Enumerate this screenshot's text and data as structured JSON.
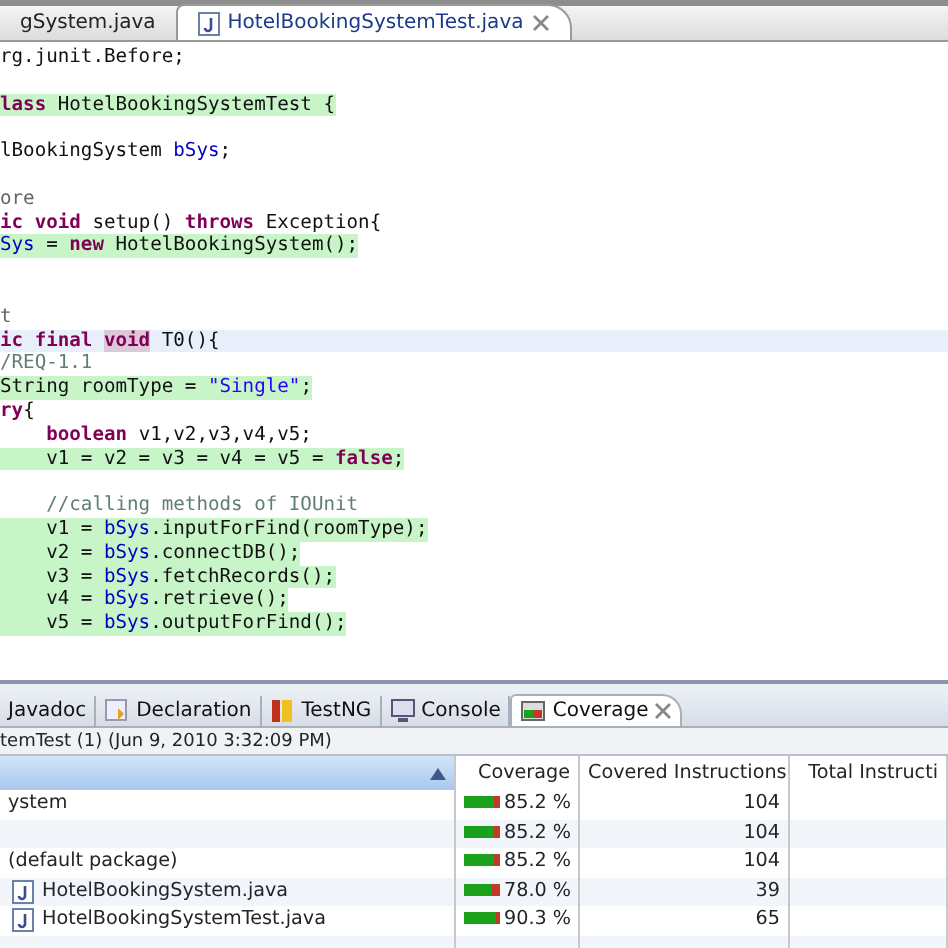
{
  "editor_tabs": [
    {
      "label": "gSystem.java",
      "selected": false,
      "closable": false,
      "icon": false
    },
    {
      "label": "HotelBookingSystemTest.java",
      "selected": true,
      "closable": true,
      "icon": true
    }
  ],
  "code_lines": [
    {
      "kind": "plain",
      "tokens": [
        {
          "kind": "plain",
          "text": "rg.junit.Before;"
        }
      ]
    },
    {
      "kind": "blank"
    },
    {
      "kind": "covered",
      "tokens": [
        {
          "kind": "keyword",
          "text": "lass"
        },
        {
          "kind": "plain",
          "text": " HotelBookingSystemTest {"
        }
      ]
    },
    {
      "kind": "blank"
    },
    {
      "kind": "plain",
      "tokens": [
        {
          "kind": "plain",
          "text": "lBookingSystem "
        },
        {
          "kind": "field",
          "text": "bSys"
        },
        {
          "kind": "plain",
          "text": ";"
        }
      ]
    },
    {
      "kind": "blank"
    },
    {
      "kind": "plain",
      "tokens": [
        {
          "kind": "annotation",
          "text": "ore"
        }
      ]
    },
    {
      "kind": "plain",
      "tokens": [
        {
          "kind": "keyword",
          "text": "ic void"
        },
        {
          "kind": "plain",
          "text": " setup() "
        },
        {
          "kind": "keyword",
          "text": "throws"
        },
        {
          "kind": "plain",
          "text": " Exception{"
        }
      ]
    },
    {
      "kind": "covered",
      "tokens": [
        {
          "kind": "field",
          "text": "Sys"
        },
        {
          "kind": "plain",
          "text": " = "
        },
        {
          "kind": "keyword",
          "text": "new"
        },
        {
          "kind": "plain",
          "text": " HotelBookingSystem();"
        }
      ]
    },
    {
      "kind": "blank"
    },
    {
      "kind": "blank"
    },
    {
      "kind": "plain",
      "tokens": [
        {
          "kind": "annotation",
          "text": "t"
        }
      ]
    },
    {
      "kind": "current",
      "tokens": [
        {
          "kind": "keyword",
          "text": "ic final "
        },
        {
          "kind": "marked",
          "text": "void"
        },
        {
          "kind": "plain",
          "text": " T0(){"
        }
      ]
    },
    {
      "kind": "plain",
      "tokens": [
        {
          "kind": "comment",
          "text": "/REQ-1.1"
        }
      ]
    },
    {
      "kind": "covered",
      "tokens": [
        {
          "kind": "plain",
          "text": "String roomType = "
        },
        {
          "kind": "string",
          "text": "\"Single\""
        },
        {
          "kind": "plain",
          "text": ";"
        }
      ]
    },
    {
      "kind": "plain",
      "tokens": [
        {
          "kind": "keyword",
          "text": "ry"
        },
        {
          "kind": "plain",
          "text": "{"
        }
      ]
    },
    {
      "kind": "plain",
      "tokens": [
        {
          "kind": "keyword",
          "text": "    boolean"
        },
        {
          "kind": "plain",
          "text": " v1,v2,v3,v4,v5;"
        }
      ]
    },
    {
      "kind": "covered",
      "tokens": [
        {
          "kind": "plain",
          "text": "    v1 = v2 = v3 = v4 = v5 = "
        },
        {
          "kind": "keyword",
          "text": "false"
        },
        {
          "kind": "plain",
          "text": ";"
        }
      ]
    },
    {
      "kind": "blank"
    },
    {
      "kind": "plain",
      "tokens": [
        {
          "kind": "comment",
          "text": "    //calling methods of IOUnit"
        }
      ]
    },
    {
      "kind": "covered",
      "tokens": [
        {
          "kind": "plain",
          "text": "    v1 = "
        },
        {
          "kind": "field",
          "text": "bSys"
        },
        {
          "kind": "plain",
          "text": ".inputForFind(roomType);"
        }
      ]
    },
    {
      "kind": "covered",
      "tokens": [
        {
          "kind": "plain",
          "text": "    v2 = "
        },
        {
          "kind": "field",
          "text": "bSys"
        },
        {
          "kind": "plain",
          "text": ".connectDB();"
        }
      ]
    },
    {
      "kind": "covered",
      "tokens": [
        {
          "kind": "plain",
          "text": "    v3 = "
        },
        {
          "kind": "field",
          "text": "bSys"
        },
        {
          "kind": "plain",
          "text": ".fetchRecords();"
        }
      ]
    },
    {
      "kind": "covered",
      "tokens": [
        {
          "kind": "plain",
          "text": "    v4 = "
        },
        {
          "kind": "field",
          "text": "bSys"
        },
        {
          "kind": "plain",
          "text": ".retrieve();"
        }
      ]
    },
    {
      "kind": "covered",
      "tokens": [
        {
          "kind": "plain",
          "text": "    v5 = "
        },
        {
          "kind": "field",
          "text": "bSys"
        },
        {
          "kind": "plain",
          "text": ".outputForFind();"
        }
      ]
    }
  ],
  "view_tabs": [
    {
      "label": "Javadoc",
      "kind": "plain",
      "selected": false,
      "closable": false
    },
    {
      "label": "Declaration",
      "kind": "declaration",
      "selected": false,
      "closable": false
    },
    {
      "label": "TestNG",
      "kind": "testng",
      "selected": false,
      "closable": false
    },
    {
      "label": "Console",
      "kind": "console",
      "selected": false,
      "closable": false
    },
    {
      "label": "Coverage",
      "kind": "coverage",
      "selected": true,
      "closable": true
    }
  ],
  "session": "temTest (1) (Jun 9, 2010 3:32:09 PM)",
  "table": {
    "columns": [
      {
        "sorted": true
      },
      {
        "label": "Coverage"
      },
      {
        "label": "Covered Instructions"
      },
      {
        "label": "Total Instructi"
      }
    ],
    "rows": [
      {
        "name": "ystem",
        "coverage": "85.2 %",
        "level": 0.852,
        "covered": "104",
        "children": [
          {
            "coverage": "85.2 %",
            "level": 0.852,
            "covered": "104",
            "children": [
              {
                "name": "(default package)",
                "coverage": "85.2 %",
                "level": 0.852,
                "covered": "104",
                "children": [
                  {
                    "name": "HotelBookingSystem.java",
                    "file": true,
                    "coverage": "78.0 %",
                    "level": 0.78,
                    "covered": "39"
                  },
                  {
                    "name": "HotelBookingSystemTest.java",
                    "file": true,
                    "coverage": "90.3 %",
                    "level": 0.903,
                    "covered": "65"
                  }
                ]
              }
            ]
          }
        ]
      }
    ]
  }
}
